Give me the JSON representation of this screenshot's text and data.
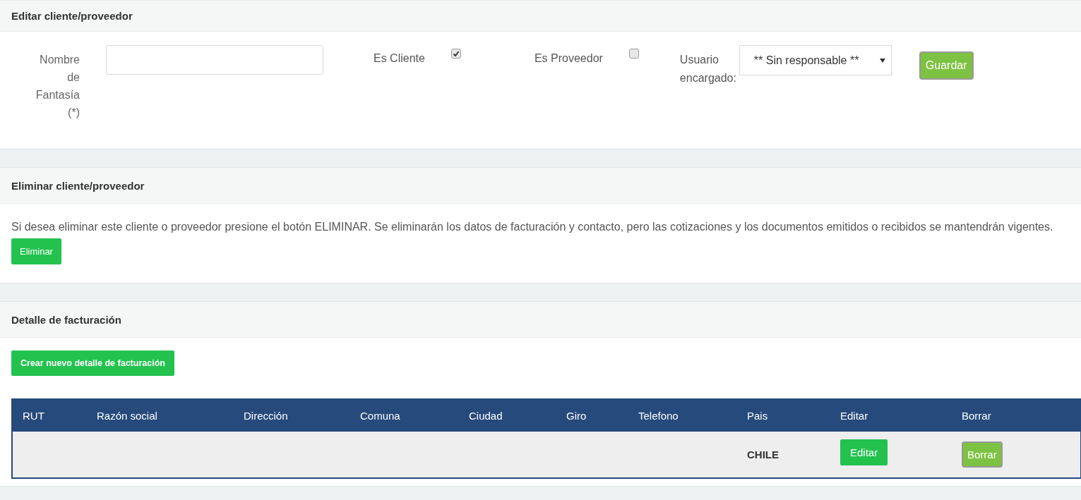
{
  "edit_panel": {
    "title": "Editar cliente/proveedor",
    "name_label": "Nombre de Fantasía (*)",
    "checkboxes": [
      {
        "label": "Es Cliente",
        "checked": true
      },
      {
        "label": "Es Proveedor",
        "checked": false
      }
    ],
    "owner_label": "Usuario encargado:",
    "owner_value": "** Sin responsable **",
    "save_button": "Guardar"
  },
  "delete_panel": {
    "title": "Eliminar cliente/proveedor",
    "text": "Si desea eliminar este cliente o proveedor presione el botón ELIMINAR. Se eliminarán los datos de facturación y contacto, pero las cotizaciones y los documentos emitidos o recibidos se mantendrán vigentes.",
    "button": "Eliminar"
  },
  "billing_panel": {
    "title": "Detalle de facturación",
    "create_button": "Crear nuevo detalle de facturación",
    "table": {
      "columns": [
        "RUT",
        "Razón social",
        "Dirección",
        "Comuna",
        "Ciudad",
        "Giro",
        "Telefono",
        "Pais",
        "Editar",
        "Borrar"
      ],
      "rows": [
        {
          "pais": "CHILE",
          "edit_button": "Editar",
          "delete_button": "Borrar"
        }
      ]
    }
  }
}
